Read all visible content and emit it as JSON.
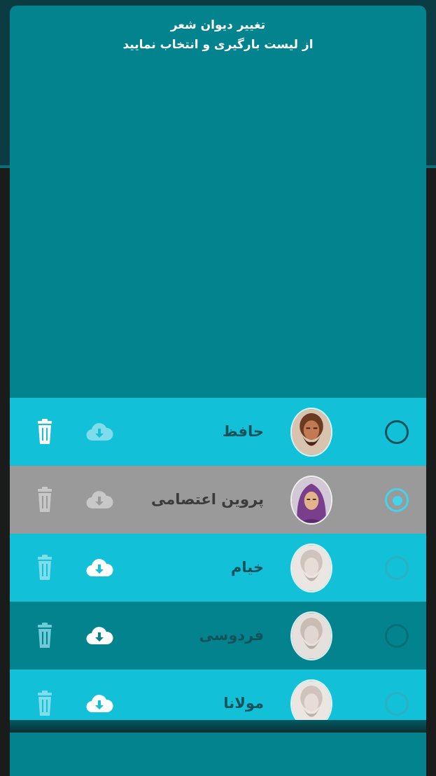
{
  "dialog": {
    "title_line1": "تغییر دیوان شعر",
    "title_line2": "از لیست بارگیری و انتخاب نمایید"
  },
  "colors": {
    "dialog_bg": "#02838e",
    "row_light": "#12c0d8",
    "row_selected": "#9a9a9a",
    "text_dark": "#14525b",
    "radio_selected": "#44d4ea"
  },
  "poets": [
    {
      "name": "حافظ",
      "selected": false,
      "portrait": "color",
      "download_icon": "cloud-download-icon",
      "delete_icon": "trash-icon"
    },
    {
      "name": "پروین اعتصامی",
      "selected": true,
      "portrait": "color",
      "download_icon": "cloud-download-icon",
      "delete_icon": "trash-icon"
    },
    {
      "name": "خیام",
      "selected": false,
      "portrait": "faded",
      "download_icon": "cloud-download-icon",
      "delete_icon": "trash-icon"
    },
    {
      "name": "فردوسی",
      "selected": false,
      "portrait": "faded",
      "download_icon": "cloud-download-icon",
      "delete_icon": "trash-icon"
    },
    {
      "name": "مولانا",
      "selected": false,
      "portrait": "faded",
      "download_icon": "cloud-download-icon",
      "delete_icon": "trash-icon"
    }
  ]
}
